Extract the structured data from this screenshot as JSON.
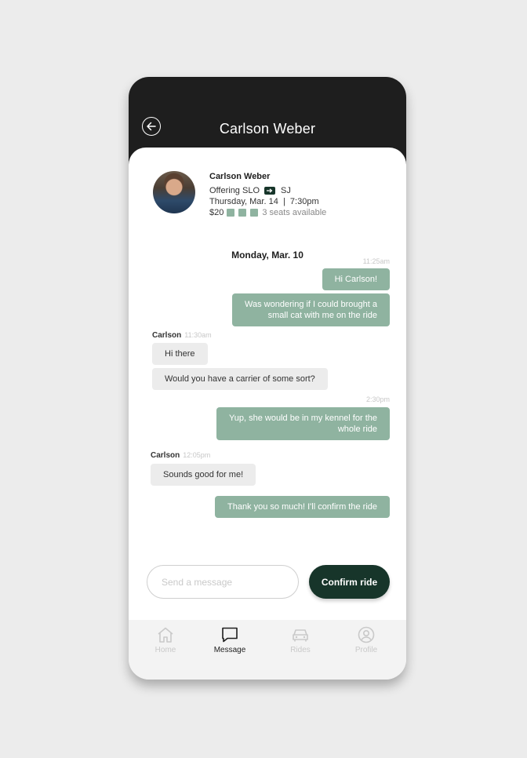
{
  "header": {
    "title": "Carlson Weber"
  },
  "ride": {
    "driver_name": "Carlson Weber",
    "offering_label": "Offering SLO",
    "destination": "SJ",
    "datetime": "Thursday, Mar. 14  |  7:30pm",
    "price": "$20",
    "seats_text": "3 seats available",
    "seats_count": 3
  },
  "chat": {
    "date": "Monday, Mar. 10",
    "time_1": "11:25am",
    "msg_1": "Hi Carlson!",
    "msg_2_line1": "Was wondering if I could brought a",
    "msg_2_line2": "small cat with me on the ride",
    "sender_1": "Carlson",
    "sender_1_time": "11:30am",
    "msg_3": "Hi there",
    "msg_4": "Would you have a carrier of some sort?",
    "time_2": "2:30pm",
    "msg_5_line1": "Yup, she would be in my kennel for the",
    "msg_5_line2": "whole ride",
    "sender_2": "Carlson",
    "sender_2_time": "12:05pm",
    "msg_6": "Sounds good for me!",
    "msg_7": "Thank you so much! I'll confirm the ride"
  },
  "composer": {
    "placeholder": "Send a message",
    "value": "",
    "confirm_label": "Confirm ride"
  },
  "nav": {
    "items": [
      {
        "label": "Home",
        "icon": "home-icon",
        "active": false
      },
      {
        "label": "Message",
        "icon": "message-icon",
        "active": true
      },
      {
        "label": "Rides",
        "icon": "car-icon",
        "active": false
      },
      {
        "label": "Profile",
        "icon": "profile-icon",
        "active": false
      }
    ]
  },
  "colors": {
    "header_bg": "#1e1e1e",
    "accent_dark": "#17352a",
    "outgoing_bubble": "#8fb3a0",
    "incoming_bubble": "#ececec",
    "inactive_nav": "#c9c9c9"
  }
}
